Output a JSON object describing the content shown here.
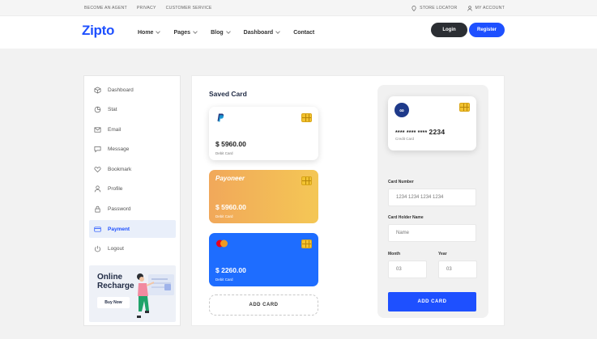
{
  "topbar": {
    "links_left": [
      "BECOME AN AGENT",
      "PRIVACY",
      "CUSTOMER SERVICE"
    ],
    "store_locator": "STORE LOCATOR",
    "my_account": "MY ACCOUNT"
  },
  "header": {
    "logo": "Zipto",
    "nav": [
      {
        "label": "Home",
        "has_dropdown": true
      },
      {
        "label": "Pages",
        "has_dropdown": true
      },
      {
        "label": "Blog",
        "has_dropdown": true
      },
      {
        "label": "Dashboard",
        "has_dropdown": true
      },
      {
        "label": "Contact",
        "has_dropdown": false
      }
    ],
    "login": "Login",
    "register": "Register"
  },
  "sidebar": {
    "items": [
      {
        "label": "Dashboard",
        "icon": "cube-icon"
      },
      {
        "label": "Stat",
        "icon": "pie-chart-icon"
      },
      {
        "label": "Email",
        "icon": "envelope-icon"
      },
      {
        "label": "Message",
        "icon": "chat-icon"
      },
      {
        "label": "Bookmark",
        "icon": "heart-icon"
      },
      {
        "label": "Profile",
        "icon": "user-icon"
      },
      {
        "label": "Password",
        "icon": "lock-icon"
      },
      {
        "label": "Payment",
        "icon": "credit-card-icon",
        "active": true
      },
      {
        "label": "Logout",
        "icon": "power-icon"
      }
    ],
    "promo": {
      "title": "Online Recharge",
      "button": "Buy Now"
    }
  },
  "main": {
    "saved_title": "Saved Card",
    "cards": [
      {
        "brand": "paypal-logo",
        "amount": "$ 5960.00",
        "type": "Debit Card",
        "style": "white"
      },
      {
        "brand": "payoneer-logo",
        "brand_text": "Payoneer",
        "amount": "$ 5960.00",
        "type": "Debit Card",
        "style": "orange"
      },
      {
        "brand": "mastercard-logo",
        "amount": "$ 2260.00",
        "type": "Debit Card",
        "style": "blue"
      }
    ],
    "add_card_outline": "ADD CARD"
  },
  "form": {
    "preview": {
      "number_masked": "**** **** ****",
      "number_last": "2234",
      "type": "Credit Card"
    },
    "card_number_label": "Card Number",
    "card_number_value": "1234 1234 1234 1234",
    "holder_label": "Card Holder Name",
    "holder_placeholder": "Name",
    "month_label": "Month",
    "month_value": "03",
    "year_label": "Year",
    "year_value": "03",
    "submit": "ADD CARD"
  },
  "colors": {
    "primary": "#1e50ff",
    "dark_button": "#2b2e33",
    "orange_start": "#f1a85a",
    "orange_end": "#f4c755",
    "blue_card": "#1e6dff"
  }
}
